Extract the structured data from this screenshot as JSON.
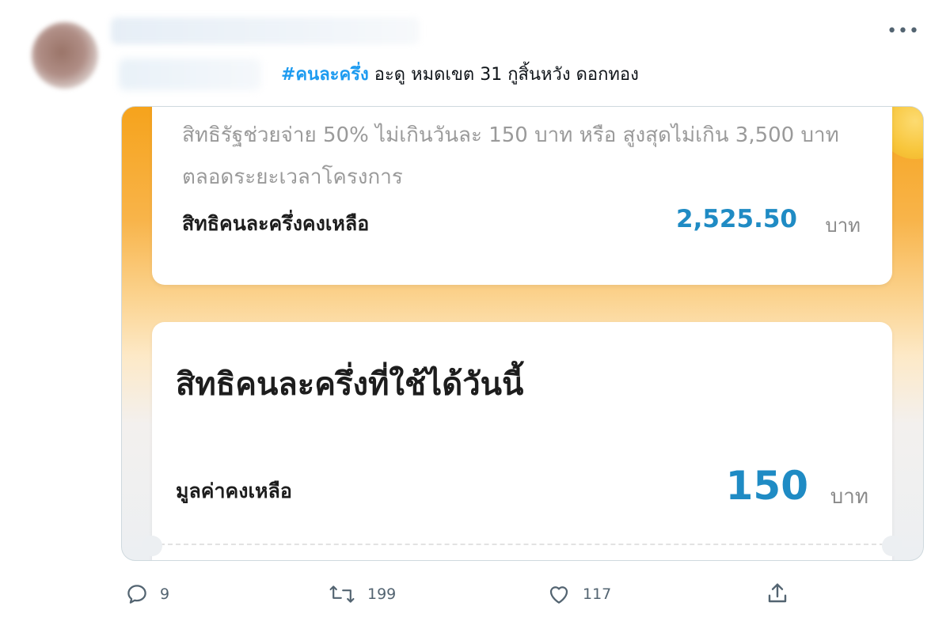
{
  "tweet": {
    "hashtag": "#คนละครึ่ง",
    "text": "อะดู หมดเขต 31 กูสิ้นหวัง ดอกทอง",
    "more_label": "•••"
  },
  "media": {
    "top_card": {
      "description": "สิทธิรัฐช่วยจ่าย 50% ไม่เกินวันละ 150 บาท หรือ สูงสุดไม่เกิน 3,500 บาทตลอดระยะเวลาโครงการ",
      "remaining_label": "สิทธิคนละครึ่งคงเหลือ",
      "remaining_value": "2,525.50",
      "unit": "บาท"
    },
    "today_card": {
      "title": "สิทธิคนละครึ่งที่ใช้ได้วันนี้",
      "balance_label": "มูลค่าคงเหลือ",
      "balance_value": "150",
      "unit": "บาท"
    }
  },
  "actions": {
    "reply_count": "9",
    "retweet_count": "199",
    "like_count": "117"
  },
  "colors": {
    "hashtag": "#1d9bf0",
    "amount": "#1f8bc4",
    "banner_orange": "#f6a31c"
  },
  "icons": [
    "more-icon",
    "reply-icon",
    "retweet-icon",
    "like-icon",
    "share-icon"
  ]
}
